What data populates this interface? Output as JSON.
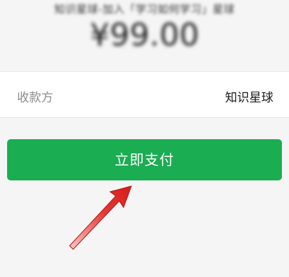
{
  "order": {
    "description": "知识星球-加入「学习如何学习」星球",
    "amount": "¥99.00"
  },
  "payee": {
    "label": "收款方",
    "value": "知识星球"
  },
  "actions": {
    "pay_label": "立即支付"
  },
  "annotation": {
    "arrow_color": "#e0201e"
  },
  "colors": {
    "button": "#1aad52",
    "background": "#f5f5f5"
  }
}
